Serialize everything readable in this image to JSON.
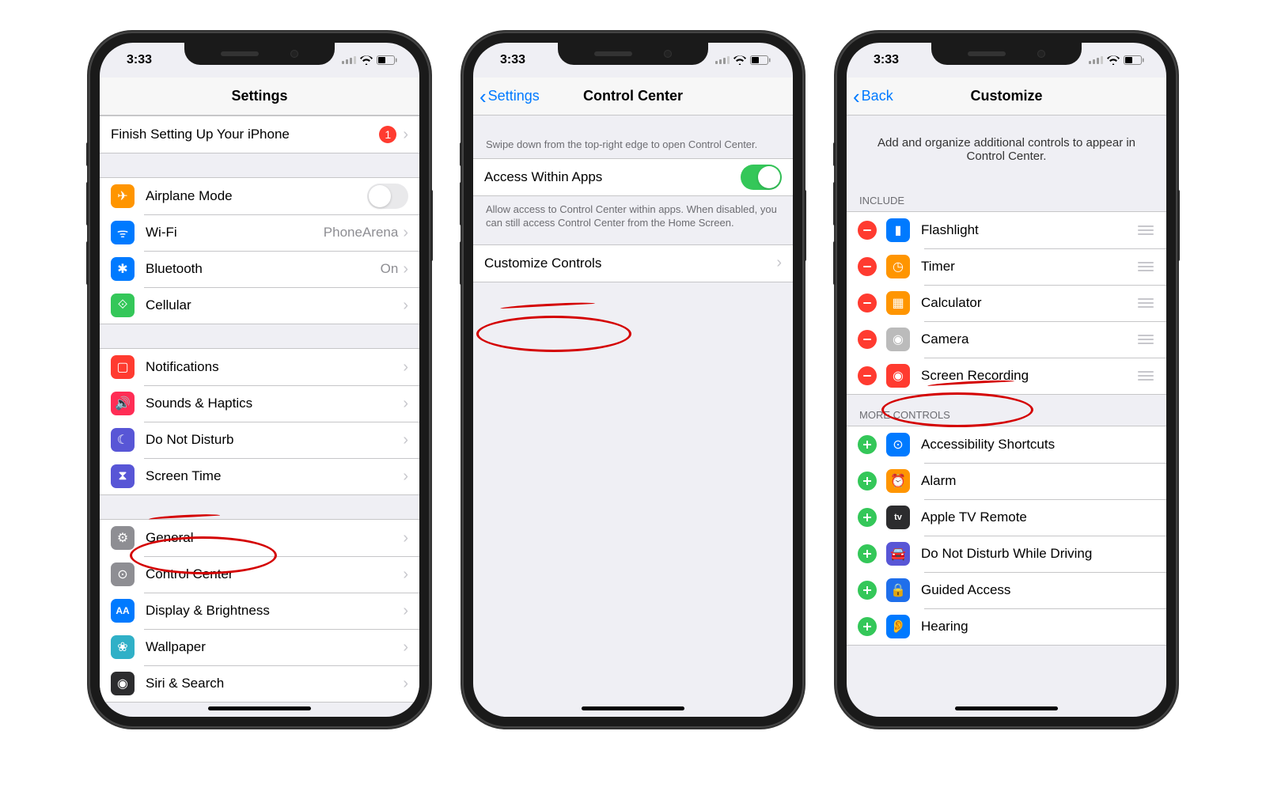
{
  "status": {
    "time": "3:33"
  },
  "screen1": {
    "title": "Settings",
    "top_row": {
      "label": "Finish Setting Up Your iPhone",
      "badge": "1"
    },
    "group1": [
      {
        "label": "Airplane Mode",
        "type": "toggle",
        "on": false,
        "icon": "airplane",
        "color": "bg-orange"
      },
      {
        "label": "Wi-Fi",
        "value": "PhoneArena",
        "icon": "wifi",
        "color": "bg-blue"
      },
      {
        "label": "Bluetooth",
        "value": "On",
        "icon": "bluetooth",
        "color": "bg-blue"
      },
      {
        "label": "Cellular",
        "icon": "antenna",
        "color": "bg-green"
      }
    ],
    "group2": [
      {
        "label": "Notifications",
        "icon": "bell",
        "color": "bg-red"
      },
      {
        "label": "Sounds & Haptics",
        "icon": "speaker",
        "color": "bg-pink"
      },
      {
        "label": "Do Not Disturb",
        "icon": "moon",
        "color": "bg-purple"
      },
      {
        "label": "Screen Time",
        "icon": "hourglass",
        "color": "bg-purple"
      }
    ],
    "group3": [
      {
        "label": "General",
        "icon": "gear",
        "color": "bg-gray"
      },
      {
        "label": "Control Center",
        "icon": "switches",
        "color": "bg-gray"
      },
      {
        "label": "Display & Brightness",
        "icon": "aa",
        "color": "bg-blue"
      },
      {
        "label": "Wallpaper",
        "icon": "flower",
        "color": "bg-teal"
      },
      {
        "label": "Siri & Search",
        "icon": "siri",
        "color": "bg-black"
      }
    ]
  },
  "screen2": {
    "back": "Settings",
    "title": "Control Center",
    "hint1": "Swipe down from the top-right edge to open Control Center.",
    "access_label": "Access Within Apps",
    "access_on": true,
    "hint2": "Allow access to Control Center within apps. When disabled, you can still access Control Center from the Home Screen.",
    "customize_label": "Customize Controls"
  },
  "screen3": {
    "back": "Back",
    "title": "Customize",
    "intro": "Add and organize additional controls to appear in Control Center.",
    "include_header": "Include",
    "include": [
      {
        "label": "Flashlight",
        "icon": "flashlight",
        "color": "bg-blue"
      },
      {
        "label": "Timer",
        "icon": "timer",
        "color": "bg-orange"
      },
      {
        "label": "Calculator",
        "icon": "calculator",
        "color": "bg-orange"
      },
      {
        "label": "Camera",
        "icon": "camera",
        "color": "bg-ltgray"
      },
      {
        "label": "Screen Recording",
        "icon": "record",
        "color": "bg-red"
      }
    ],
    "more_header": "More Controls",
    "more": [
      {
        "label": "Accessibility Shortcuts",
        "icon": "accessibility",
        "color": "bg-blue"
      },
      {
        "label": "Alarm",
        "icon": "alarm",
        "color": "bg-orange"
      },
      {
        "label": "Apple TV Remote",
        "icon": "tv",
        "color": "bg-black"
      },
      {
        "label": "Do Not Disturb While Driving",
        "icon": "car",
        "color": "bg-purple"
      },
      {
        "label": "Guided Access",
        "icon": "lock",
        "color": "bg-darkblue"
      },
      {
        "label": "Hearing",
        "icon": "ear",
        "color": "bg-blue"
      }
    ]
  },
  "icons": {
    "airplane": "✈",
    "wifi": "ᯤ",
    "bluetooth": "✱",
    "antenna": "⟐",
    "bell": "▢",
    "speaker": "🔊",
    "moon": "☾",
    "hourglass": "⧗",
    "gear": "⚙",
    "switches": "⊙",
    "aa": "AA",
    "flower": "❀",
    "siri": "◉",
    "flashlight": "▮",
    "timer": "◷",
    "calculator": "▦",
    "camera": "◉",
    "record": "◉",
    "accessibility": "⊙",
    "alarm": "⏰",
    "tv": "tv",
    "car": "🚘",
    "lock": "🔒",
    "ear": "👂"
  }
}
